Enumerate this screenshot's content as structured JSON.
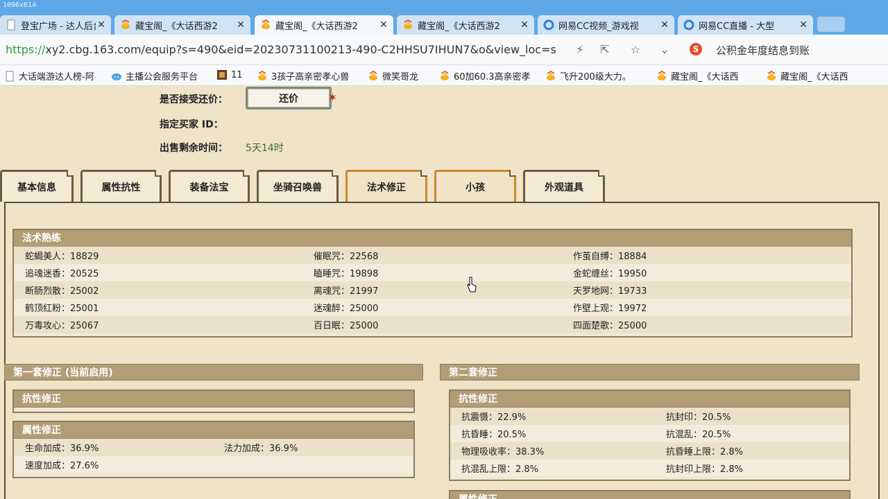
{
  "browser": {
    "corner_label": "1096x614",
    "tabs": [
      {
        "label": "登宝广场 - 达人后台",
        "icon": "page-icon"
      },
      {
        "label": "藏宝阁_《大话西游2",
        "icon": "cbg-duck-icon"
      },
      {
        "label": "藏宝阁_《大话西游2",
        "icon": "cbg-duck-icon"
      },
      {
        "label": "藏宝阁_《大话西游2",
        "icon": "cbg-duck-icon"
      },
      {
        "label": "网易CC视频_游戏视",
        "icon": "cc-icon"
      },
      {
        "label": "网易CC直播 - 大型",
        "icon": "cc-icon"
      }
    ],
    "url_scheme": "https://",
    "url_rest": "xy2.cbg.163.com/equip?s=490&eid=20230731100213-490-C2HHSU7IHUN7&o&view_loc=s",
    "search_text": "公积金年度结息到账",
    "bookmarks": [
      {
        "label": "大话端游达人榜-阿",
        "icon": "page-icon"
      },
      {
        "label": "主播公会服务平台",
        "icon": "cloud-icon"
      },
      {
        "label": "11",
        "icon": "game-icon"
      },
      {
        "label": "3孩子高亲密孝心兽",
        "icon": "cbg-duck-icon"
      },
      {
        "label": "微笑哥龙",
        "icon": "cbg-duck-icon"
      },
      {
        "label": "60加60.3高亲密孝",
        "icon": "cbg-duck-icon"
      },
      {
        "label": "飞升200级大力。",
        "icon": "cbg-duck-icon"
      },
      {
        "label": "藏宝阁_《大话西",
        "icon": "cbg-duck-icon"
      },
      {
        "label": "藏宝阁_《大话西",
        "icon": "cbg-duck-icon"
      }
    ]
  },
  "info": {
    "bargain_label": "是否接受还价：",
    "bargain_button": "还价",
    "buyer_label": "指定买家 ID：",
    "remaining_label": "出售剩余时间：",
    "remaining_value": "5天14时"
  },
  "tabs": [
    "基本信息",
    "属性抗性",
    "装备法宝",
    "坐骑召唤兽",
    "法术修正",
    "小孩",
    "外观道具"
  ],
  "skills": {
    "title": "法术熟练",
    "rows": [
      [
        "蛇蝎美人：18829",
        "催眠咒：22568",
        "作茧自缚：18884"
      ],
      [
        "追魂迷香：20525",
        "瞌睡咒：19898",
        "金蛇缠丝：19950"
      ],
      [
        "断肠烈散：25002",
        "离魂咒：21997",
        "天罗地网：19733"
      ],
      [
        "鹤顶红粉：25001",
        "迷魂醉：25000",
        "作壁上观：19972"
      ],
      [
        "万毒攻心：25067",
        "百日眠：25000",
        "四面楚歌：25000"
      ]
    ]
  },
  "set1": {
    "title": "第一套修正 (当前启用)",
    "resist_title": "抗性修正",
    "attr_title": "属性修正",
    "attr_rows": [
      [
        "生命加成：36.9%",
        "法力加成：36.9%"
      ],
      [
        "速度加成：27.6%",
        ""
      ]
    ]
  },
  "set2": {
    "title": "第二套修正",
    "resist_title": "抗性修正",
    "resist_rows": [
      [
        "抗震慑：22.9%",
        "抗封印：20.5%"
      ],
      [
        "抗昏睡：20.5%",
        "抗混乱：20.5%"
      ],
      [
        "物理吸收率：38.3%",
        "抗昏睡上限：2.8%"
      ],
      [
        "抗混乱上限：2.8%",
        "抗封印上限：2.8%"
      ]
    ],
    "next_title": "属性修正"
  }
}
